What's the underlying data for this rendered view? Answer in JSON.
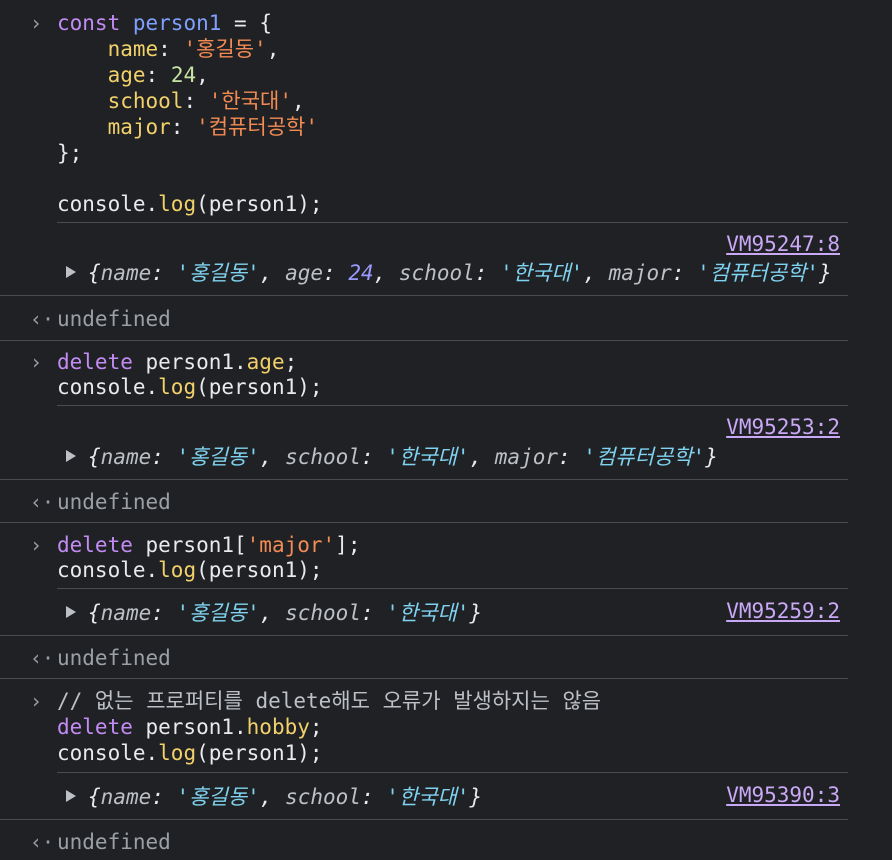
{
  "entries": [
    {
      "input": {
        "l1": {
          "kw": "const",
          "var": "person1",
          "rest": " = {"
        },
        "l2": {
          "prop": "name",
          "colon": ": ",
          "val": "'홍길동'",
          "tail": ","
        },
        "l3": {
          "prop": "age",
          "colon": ": ",
          "val": "24",
          "tail": ","
        },
        "l4": {
          "prop": "school",
          "colon": ": ",
          "val": "'한국대'",
          "tail": ","
        },
        "l5": {
          "prop": "major",
          "colon": ": ",
          "val": "'컴퓨터공학'"
        },
        "l6": "};",
        "l7": {
          "pre": "console.",
          "fn": "log",
          "post": "(person1);"
        }
      },
      "source": "VM95247:8",
      "object": {
        "open": "{",
        "name_key": "name",
        "name_val": "'홍길동'",
        "age_key": "age",
        "age_val": "24",
        "school_key": "school",
        "school_val": "'한국대'",
        "major_key": "major",
        "major_val": "'컴퓨터공학'",
        "close": "}"
      },
      "result": "undefined"
    },
    {
      "input": {
        "l1": {
          "kw": "delete",
          "pre": " person1.",
          "prop": "age",
          "post": ";"
        },
        "l2": {
          "pre": "console.",
          "fn": "log",
          "post": "(person1);"
        }
      },
      "source": "VM95253:2",
      "object": {
        "name_key": "name",
        "name_val": "'홍길동'",
        "school_key": "school",
        "school_val": "'한국대'",
        "major_key": "major",
        "major_val": "'컴퓨터공학'"
      },
      "result": "undefined"
    },
    {
      "input": {
        "l1": {
          "kw": "delete",
          "pre": " person1[",
          "str": "'major'",
          "post": "];"
        },
        "l2": {
          "pre": "console.",
          "fn": "log",
          "post": "(person1);"
        }
      },
      "source": "VM95259:2",
      "object": {
        "name_key": "name",
        "name_val": "'홍길동'",
        "school_key": "school",
        "school_val": "'한국대'"
      },
      "result": "undefined"
    },
    {
      "input": {
        "comment": "// 없는 프로퍼티를 delete해도 오류가 발생하지는 않음",
        "l1": {
          "kw": "delete",
          "pre": " person1.",
          "prop": "hobby",
          "post": ";"
        },
        "l2": {
          "pre": "console.",
          "fn": "log",
          "post": "(person1);"
        }
      },
      "source": "VM95390:3",
      "object": {
        "name_key": "name",
        "name_val": "'홍길동'",
        "school_key": "school",
        "school_val": "'한국대'"
      },
      "result": "undefined"
    }
  ],
  "icons": {
    "input_prompt": "chevron-right-icon",
    "result_prompt": "return-arrow-icon",
    "expand": "triangle-right-icon"
  },
  "colors": {
    "background": "#202124",
    "keyword": "#c38cf5",
    "string": "#f28b54",
    "property": "#f2d16b",
    "link": "#c9a8f5"
  }
}
